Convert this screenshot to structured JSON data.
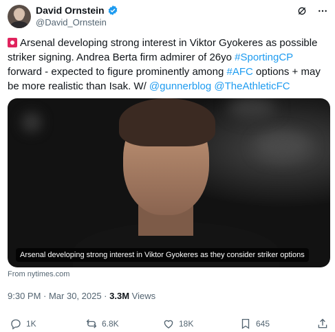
{
  "author": {
    "display_name": "David Ornstein",
    "handle": "@David_Ornstein",
    "verified_color": "#1d9bf0"
  },
  "tweet": {
    "emoji_icon": "siren-icon",
    "text_part1": "Arsenal developing strong interest in Viktor Gyokeres as possible striker signing. Andrea Berta firm admirer of 26yo ",
    "hashtag1": "#SportingCP",
    "text_part2": " forward - expected to figure prominently among ",
    "hashtag2": "#AFC",
    "text_part3": " options + may be more realistic than Isak. W/ ",
    "mention1": "@gunnerblog",
    "mention2": "@TheAthleticFC"
  },
  "media": {
    "caption": "Arsenal developing strong interest in Viktor Gyokeres as they consider striker options",
    "source": "From nytimes.com"
  },
  "meta": {
    "timestamp": "9:30 PM · Mar 30, 2025 · ",
    "views_count": "3.3M",
    "views_label": " Views"
  },
  "actions": {
    "replies": "1K",
    "retweets": "6.8K",
    "likes": "18K",
    "bookmarks": "645"
  },
  "colors": {
    "link": "#1d9bf0",
    "muted": "#536471",
    "text": "#0f1419"
  }
}
